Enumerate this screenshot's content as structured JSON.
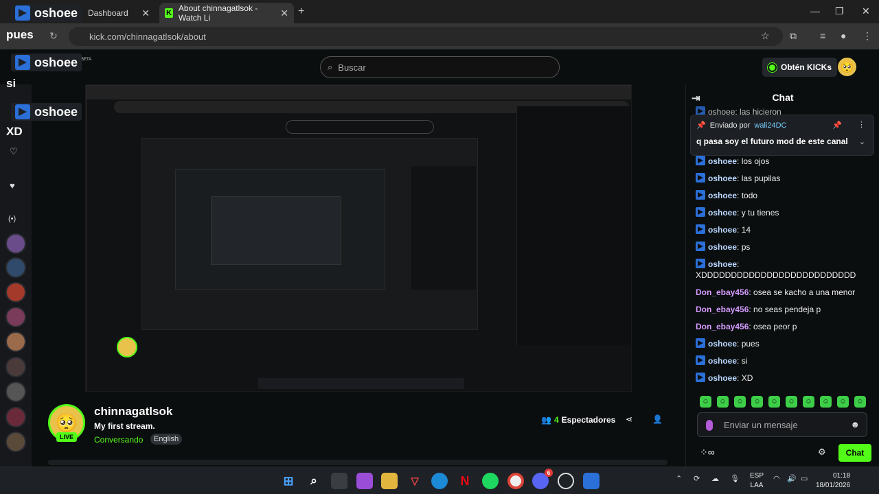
{
  "browser": {
    "tabs": [
      {
        "label": "Dashboard"
      },
      {
        "label": "About chinnagatlsok - Watch Li"
      }
    ],
    "url": "kick.com/chinnagatlsok/about"
  },
  "header": {
    "search_placeholder": "Buscar",
    "kicks_label": "Obtén KICKs",
    "beta": "BETA"
  },
  "overlays": {
    "user1": "oshoee",
    "text1": "pues",
    "user2": "oshoee",
    "text2": "si",
    "user3": "oshoee",
    "text3": "XD",
    "counter": "4"
  },
  "chat": {
    "title": "Chat",
    "partial_top": "oshoee: las hicieron",
    "pinned": {
      "sent_by_label": "Enviado por",
      "user": "wali24DC",
      "text": "q pasa soy el futuro mod de este canal"
    },
    "messages": [
      {
        "user": "oshoee",
        "text": "los ojos",
        "color": "#b9d7ff",
        "badge": true
      },
      {
        "user": "oshoee",
        "text": "las pupilas",
        "color": "#b9d7ff",
        "badge": true
      },
      {
        "user": "oshoee",
        "text": "todo",
        "color": "#b9d7ff",
        "badge": true
      },
      {
        "user": "oshoee",
        "text": "y tu tienes",
        "color": "#b9d7ff",
        "badge": true
      },
      {
        "user": "oshoee",
        "text": "14",
        "color": "#b9d7ff",
        "badge": true
      },
      {
        "user": "oshoee",
        "text": "ps",
        "color": "#b9d7ff",
        "badge": true
      },
      {
        "user": "oshoee",
        "text": "XDDDDDDDDDDDDDDDDDDDDDDDDDD",
        "color": "#b9d7ff",
        "badge": true,
        "wrap": true
      },
      {
        "user": "Don_ebay456",
        "text": "osea se kacho a una menor",
        "color": "#d59bff",
        "badge": false
      },
      {
        "user": "Don_ebay456",
        "text": "no seas pendeja p",
        "color": "#d59bff",
        "badge": false
      },
      {
        "user": "Don_ebay456",
        "text": "osea peor p",
        "color": "#d59bff",
        "badge": false
      },
      {
        "user": "oshoee",
        "text": "pues",
        "color": "#b9d7ff",
        "badge": true
      },
      {
        "user": "oshoee",
        "text": "si",
        "color": "#b9d7ff",
        "badge": true
      },
      {
        "user": "oshoee",
        "text": "XD",
        "color": "#b9d7ff",
        "badge": true
      }
    ],
    "input_placeholder": "Enviar un mensaje",
    "send_label": "Chat"
  },
  "streamer": {
    "name": "chinnagatlsok",
    "title": "My first stream.",
    "category": "Conversando",
    "language": "English",
    "live_label": "LIVE",
    "viewers_count": "4",
    "viewers_label": "Espectadores"
  },
  "taskbar": {
    "lang_top": "ESP",
    "lang_bottom": "LAA",
    "time": "01:18",
    "date": "18/01/2026",
    "discord_badge": "6"
  },
  "colors": {
    "kick_green": "#53fc18",
    "background": "#0b0e0f",
    "mod_blue": "#2b6fd8"
  }
}
